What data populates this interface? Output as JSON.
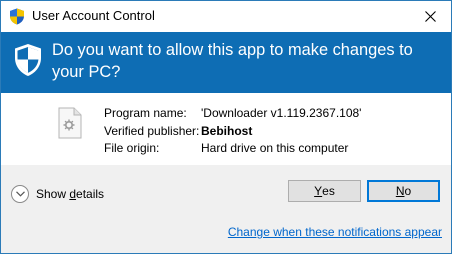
{
  "window": {
    "title": "User Account Control",
    "close_icon": "close-icon"
  },
  "header": {
    "question": "Do you want to allow this app to make changes to your PC?",
    "icon": "uac-shield-icon",
    "background_color": "#0e6db4"
  },
  "app_info": {
    "icon": "generic-application-icon",
    "program_name_label": "Program name:",
    "program_name_value": "'Downloader  v1.119.2367.108'",
    "publisher_label": "Verified publisher:",
    "publisher_value": "Bebihost",
    "origin_label": "File origin:",
    "origin_value": "Hard drive on this computer"
  },
  "footer": {
    "show_details_prefix": "Show ",
    "show_details_mnemonic": "d",
    "show_details_suffix": "etails",
    "yes_mnemonic": "Y",
    "yes_suffix": "es",
    "no_mnemonic": "N",
    "no_suffix": "o",
    "notifications_link": "Change when these notifications appear",
    "accent_color": "#0078d7",
    "link_color": "#0066cc"
  }
}
